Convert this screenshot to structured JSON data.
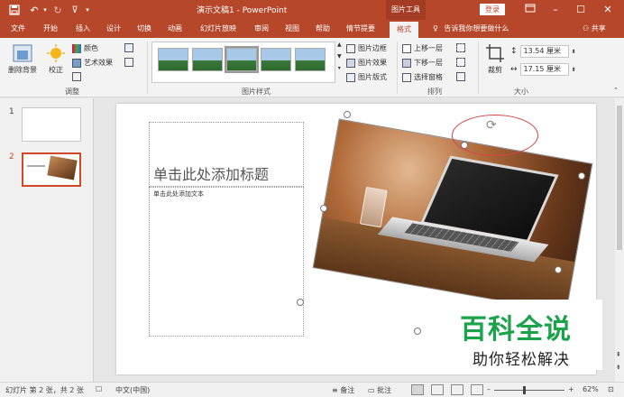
{
  "titlebar": {
    "doc_title": "演示文稿1  -  PowerPoint",
    "context_tab": "图片工具",
    "login": "登录",
    "save_icon": "save-icon",
    "undo_icon": "undo-icon",
    "redo_icon": "redo-icon",
    "customize_icon": "customize-icon"
  },
  "tabs": [
    {
      "label": "文件"
    },
    {
      "label": "开始"
    },
    {
      "label": "插入"
    },
    {
      "label": "设计"
    },
    {
      "label": "切换"
    },
    {
      "label": "动画"
    },
    {
      "label": "幻灯片放映"
    },
    {
      "label": "审阅"
    },
    {
      "label": "视图"
    },
    {
      "label": "帮助"
    },
    {
      "label": "情节提要"
    },
    {
      "label": "格式",
      "active": true
    }
  ],
  "tell_me": "告诉我你想要做什么",
  "share": "共享",
  "ribbon": {
    "remove_bg": "删除背景",
    "correct": "校正",
    "color": "颜色",
    "artistic": "艺术效果",
    "adjust_group": "调整",
    "styles_group": "图片样式",
    "border": "图片边框",
    "effects": "图片效果",
    "layout": "图片版式",
    "bring_forward": "上移一层",
    "send_backward": "下移一层",
    "selection_pane": "选择窗格",
    "arrange_group": "排列",
    "crop": "裁剪",
    "height": "13.54 厘米",
    "width": "17.15 厘米",
    "size_group": "大小"
  },
  "slides_panel": {
    "slides": [
      {
        "number": "1"
      },
      {
        "number": "2"
      }
    ]
  },
  "slide": {
    "title_placeholder": "单击此处添加标题",
    "body_placeholder": "单击此处添加文本"
  },
  "watermark": {
    "line1": "百科全说",
    "line2": "助你轻松解决"
  },
  "statusbar": {
    "slide_info": "幻灯片 第 2 张，共 2 张",
    "language": "中文(中国)",
    "notes": "备注",
    "comments": "批注",
    "zoom": "62%",
    "zoom_percent": 62
  },
  "colors": {
    "accent": "#b7472a",
    "selection": "#d24726",
    "watermark_green": "#1aa34a"
  }
}
